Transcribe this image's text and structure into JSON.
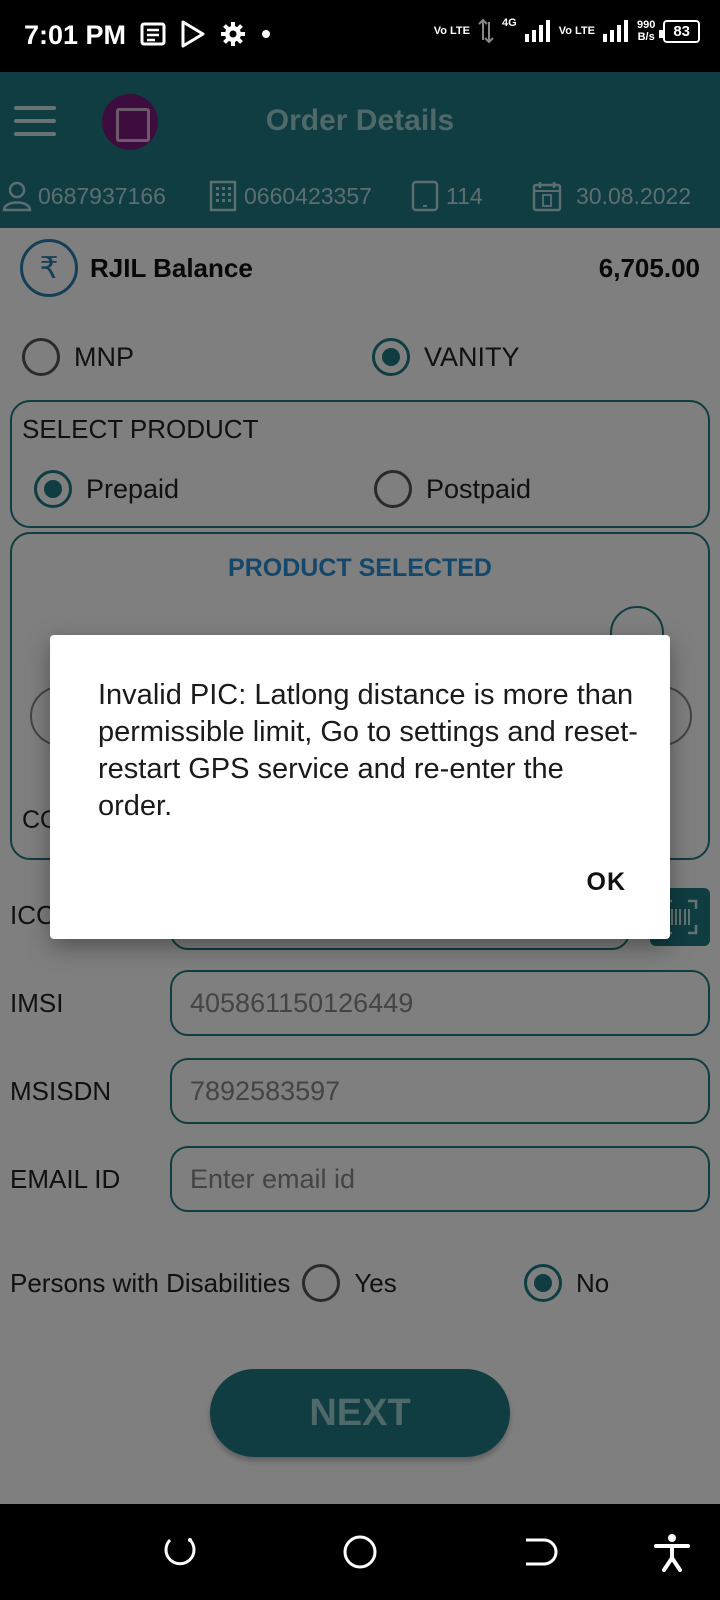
{
  "status_bar": {
    "time": "7:01 PM",
    "lte1": "Vo LTE",
    "net": "4G",
    "lte2": "Vo LTE",
    "speed_value": "990",
    "speed_unit": "B/s",
    "battery": "83"
  },
  "app_bar": {
    "title": "Order Details"
  },
  "info_strip": {
    "user_id": "0687937166",
    "store_id": "0660423357",
    "device_count": "114",
    "date": "30.08.2022"
  },
  "balance": {
    "label": "RJIL Balance",
    "value": "6,705.00"
  },
  "order_type": {
    "options": [
      {
        "label": "MNP",
        "selected": false
      },
      {
        "label": "VANITY",
        "selected": true
      }
    ]
  },
  "select_product": {
    "title": "SELECT PRODUCT",
    "options": [
      {
        "label": "Prepaid",
        "selected": true
      },
      {
        "label": "Postpaid",
        "selected": false
      }
    ]
  },
  "product_selected": {
    "title": "PRODUCT SELECTED",
    "partial_label": "CO"
  },
  "form": {
    "iccid_label": "ICCID",
    "imsi_label": "IMSI",
    "imsi_value": "405861150126449",
    "msisdn_label": "MSISDN",
    "msisdn_value": "7892583597",
    "email_label": "EMAIL ID",
    "email_placeholder": "Enter email id"
  },
  "disabilities": {
    "label": "Persons with Disabilities",
    "options": [
      {
        "label": "Yes",
        "selected": false
      },
      {
        "label": "No",
        "selected": true
      }
    ]
  },
  "next_label": "NEXT",
  "dialog": {
    "message": "Invalid PIC: Latlong distance is more than permissible limit, Go to settings and reset-restart GPS service and re-enter the order.",
    "ok_label": "OK"
  },
  "colors": {
    "primary": "#1f7b82",
    "accent_blue": "#2b8fd6"
  }
}
